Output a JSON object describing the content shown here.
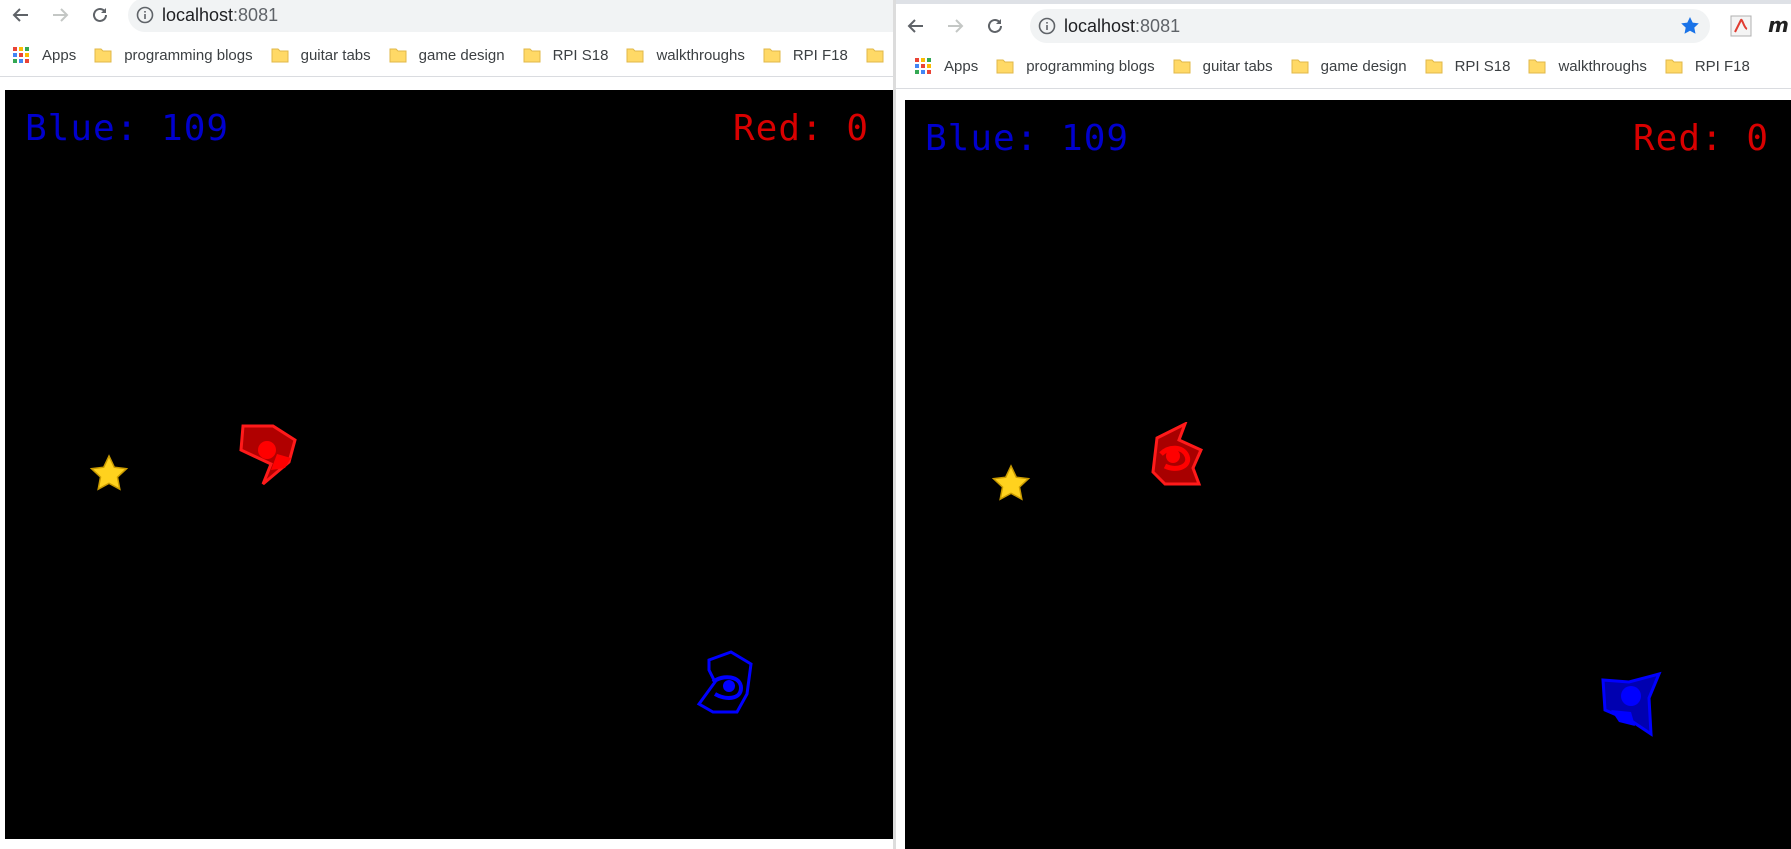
{
  "colors": {
    "blue_team": "#0000cd",
    "red_team": "#d80000",
    "star": "#ffd21e",
    "canvas": "#000000"
  },
  "left_window": {
    "url_host": "localhost",
    "url_port": ":8081",
    "bookmarks": [
      {
        "label": "Apps",
        "icon": "apps-grid-icon"
      },
      {
        "label": "programming blogs",
        "icon": "folder-icon"
      },
      {
        "label": "guitar tabs",
        "icon": "folder-icon"
      },
      {
        "label": "game design",
        "icon": "folder-icon"
      },
      {
        "label": "RPI S18",
        "icon": "folder-icon"
      },
      {
        "label": "walkthroughs",
        "icon": "folder-icon"
      },
      {
        "label": "RPI F18",
        "icon": "folder-icon"
      }
    ],
    "game": {
      "blue_score_text": "Blue: 109",
      "red_score_text": "Red: 0"
    }
  },
  "right_window": {
    "url_host": "localhost",
    "url_port": ":8081",
    "bookmarks": [
      {
        "label": "Apps",
        "icon": "apps-grid-icon"
      },
      {
        "label": "programming blogs",
        "icon": "folder-icon"
      },
      {
        "label": "guitar tabs",
        "icon": "folder-icon"
      },
      {
        "label": "game design",
        "icon": "folder-icon"
      },
      {
        "label": "RPI S18",
        "icon": "folder-icon"
      },
      {
        "label": "walkthroughs",
        "icon": "folder-icon"
      },
      {
        "label": "RPI F18",
        "icon": "folder-icon"
      }
    ],
    "extension_partial_text": "m",
    "game": {
      "blue_score_text": "Blue: 109",
      "red_score_text": "Red: 0"
    }
  }
}
